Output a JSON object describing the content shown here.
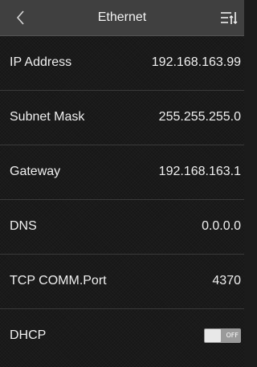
{
  "header": {
    "title": "Ethernet",
    "back_icon": "chevron-left-icon",
    "menu_icon": "sort-menu-icon"
  },
  "rows": [
    {
      "label": "IP Address",
      "value": "192.168.163.99"
    },
    {
      "label": "Subnet Mask",
      "value": "255.255.255.0"
    },
    {
      "label": "Gateway",
      "value": "192.168.163.1"
    },
    {
      "label": "DNS",
      "value": "0.0.0.0"
    },
    {
      "label": "TCP COMM.Port",
      "value": "4370"
    },
    {
      "label": "DHCP",
      "toggle_text": "OFF",
      "toggle_on": false
    }
  ],
  "colors": {
    "header_bg": "#404040",
    "screen_bg": "#1a1a1a",
    "text": "#f0f0f0",
    "toggle_bg": "#9a9a9a"
  }
}
